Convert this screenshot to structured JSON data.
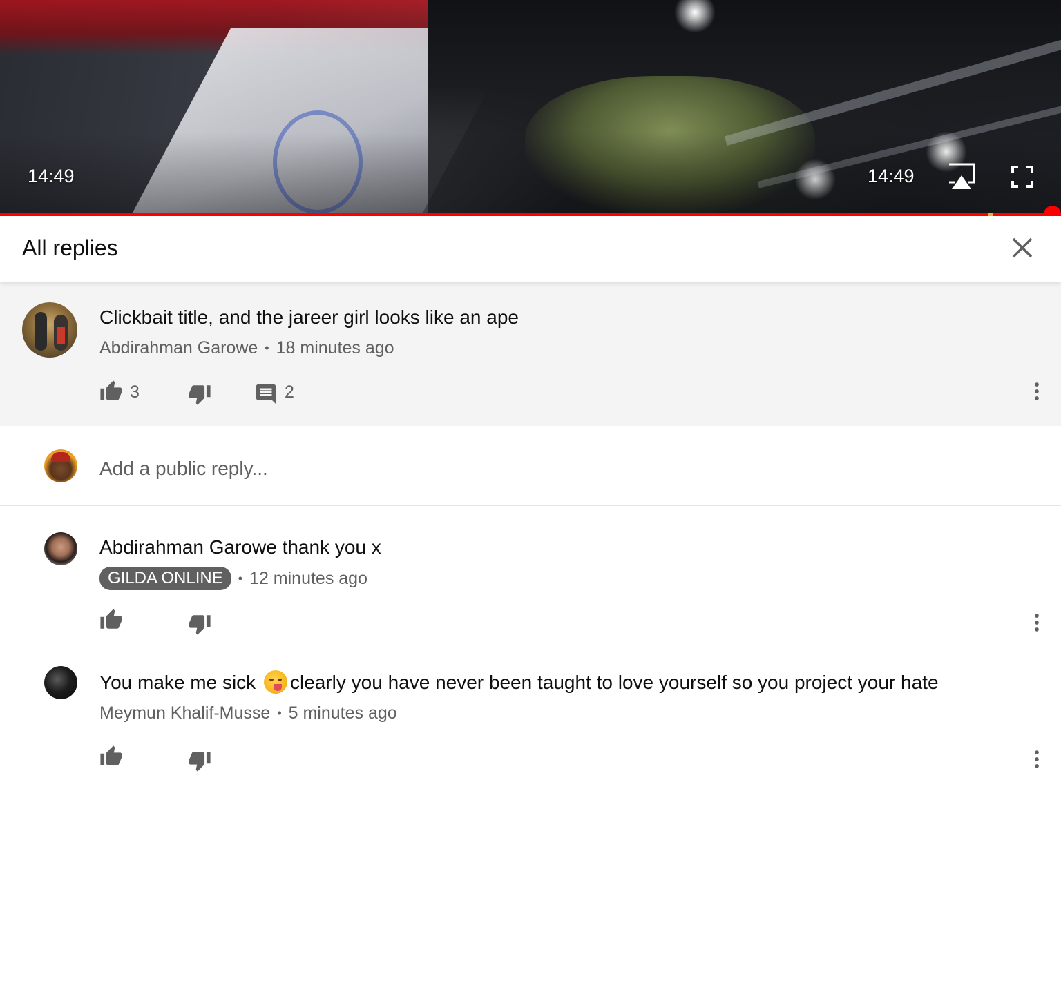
{
  "player": {
    "time_current": "14:49",
    "time_duration": "14:49",
    "progress_fraction": 0.99,
    "icons": [
      "airplay-icon",
      "fullscreen-icon"
    ]
  },
  "header": {
    "title": "All replies",
    "close_icon": "close-icon"
  },
  "parent_comment": {
    "text": "Clickbait title, and the jareer girl looks like an ape",
    "author": "Abdirahman Garowe",
    "separator": "•",
    "time": "18 minutes ago",
    "likes": "3",
    "replies": "2"
  },
  "reply_box": {
    "placeholder": "Add a public reply..."
  },
  "replies": [
    {
      "text": "Abdirahman Garowe thank you x",
      "author": "GILDA ONLINE",
      "author_is_badge": true,
      "separator": "•",
      "time": "12 minutes ago"
    },
    {
      "text_before_emoji": "You make me sick",
      "emoji": "drooling-face-emoji",
      "text_after_emoji": "clearly you have never been taught to love yourself so you project your hate",
      "author": "Meymun Khalif-Musse",
      "separator": "•",
      "time": "5 minutes ago"
    }
  ],
  "colors": {
    "progress": "#ff0000",
    "meta_text": "#606060",
    "parent_bg": "#f4f4f4",
    "badge_bg": "#606060"
  }
}
